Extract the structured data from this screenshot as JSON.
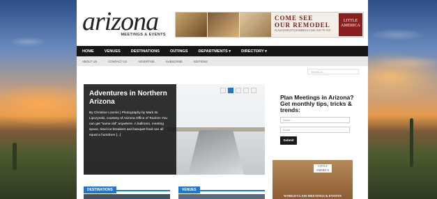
{
  "logo": {
    "word": "arizona",
    "subtitle": "MEETINGS & EVENTS"
  },
  "ad_banner": {
    "line1": "COME SEE",
    "line2": "OUR REMODEL",
    "line3": "FLAGSTAFFLITTLEAMERICA.COM | 928-779-7947",
    "brand": "LITTLE AMERICA"
  },
  "nav": {
    "items": [
      "HOME",
      "VENUES",
      "DESTINATIONS",
      "OUTINGS",
      "DEPARTMENTS ▾",
      "DIRECTORY ▾"
    ]
  },
  "subnav": {
    "items": [
      "ABOUT US",
      "CONTACT US",
      "ADVERTISE",
      "SUBSCRIBE",
      "EDITIONS"
    ]
  },
  "search": {
    "placeholder": "SEARCH ..."
  },
  "slider": {
    "title": "Adventures in Northern Arizona",
    "excerpt": "By Christine Loomis | Photography by Mark W. Lipczynski, courtesy of Arizona Office of Tourism You can get \"same old\" anywhere. A ballroom, meeting space, tired ice-breakers and banquet food can all equal a humdrum [...]",
    "dots": 5,
    "active_dot": 2
  },
  "sections": {
    "left": "DESTINATIONS",
    "right": "VENUES"
  },
  "signup": {
    "heading": "Plan Meetings in Arizona? Get monthly tips, tricks & trends:",
    "name_placeholder": "Name",
    "email_placeholder": "Email",
    "submit_label": "Submit"
  },
  "side_ad": {
    "brand": "LITTLE AMERICA",
    "caption": "WORLD-CLASS MEETINGS & EVENTS"
  },
  "colors": {
    "accent": "#2176c9",
    "nav_bg": "#161616",
    "subnav_bg": "#e9e9e9"
  }
}
